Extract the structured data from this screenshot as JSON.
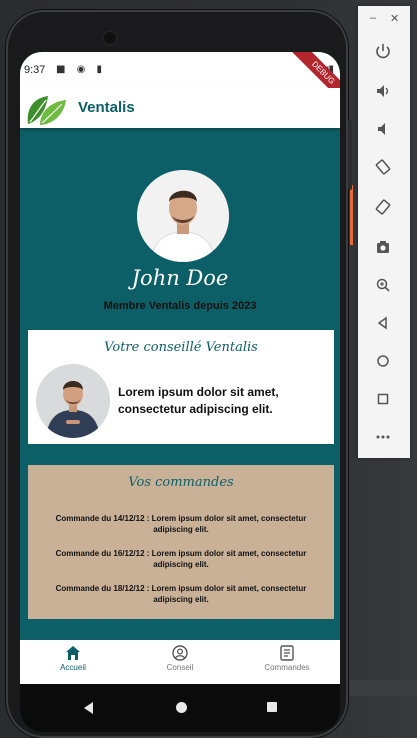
{
  "status": {
    "time": "9:37",
    "debug_banner": "DEBUG"
  },
  "appbar": {
    "title": "Ventalis"
  },
  "profile": {
    "name": "John Doe",
    "member_since": "Membre Ventalis depuis 2023"
  },
  "advisor": {
    "title": "Votre conseillé Ventalis",
    "text": "Lorem ipsum dolor sit amet, consectetur adipiscing elit."
  },
  "orders": {
    "title": "Vos commandes",
    "items": [
      "Commande du 14/12/12 : Lorem ipsum dolor sit amet, consectetur adipiscing elit.",
      "Commande du 16/12/12 : Lorem ipsum dolor sit amet, consectetur adipiscing elit.",
      "Commande du 18/12/12 : Lorem ipsum dolor sit amet, consectetur adipiscing elit."
    ]
  },
  "bottom_nav": [
    {
      "label": "Accueil",
      "icon": "home-icon",
      "active": true
    },
    {
      "label": "Conseil",
      "icon": "advisor-icon",
      "active": false
    },
    {
      "label": "Commandes",
      "icon": "orders-icon",
      "active": false
    }
  ],
  "colors": {
    "primary": "#0c5f66",
    "orders_bg": "#c9b198",
    "leaf_green": "#5cae3a"
  },
  "emulator_toolbar": [
    "power-icon",
    "volume-up-icon",
    "volume-down-icon",
    "rotate-left-icon",
    "rotate-right-icon",
    "camera-icon",
    "zoom-icon",
    "back-icon",
    "home-icon",
    "overview-icon",
    "more-icon"
  ]
}
